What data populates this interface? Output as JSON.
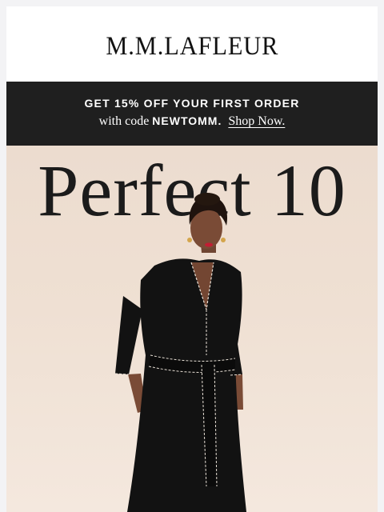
{
  "brand": {
    "logo_text": "M.M.LAFLEUR"
  },
  "promo": {
    "headline": "GET 15% OFF YOUR FIRST ORDER",
    "code_prefix": "with code",
    "code": "NEWTOMM.",
    "link_label": "Shop Now."
  },
  "hero": {
    "title": "Perfect 10",
    "image": "model-in-black-belted-dress"
  },
  "colors": {
    "page_bg": "#f3f3f5",
    "promo_bg": "#1f1f1f",
    "hero_bg": "#efe0d3",
    "dress": "#121212"
  }
}
